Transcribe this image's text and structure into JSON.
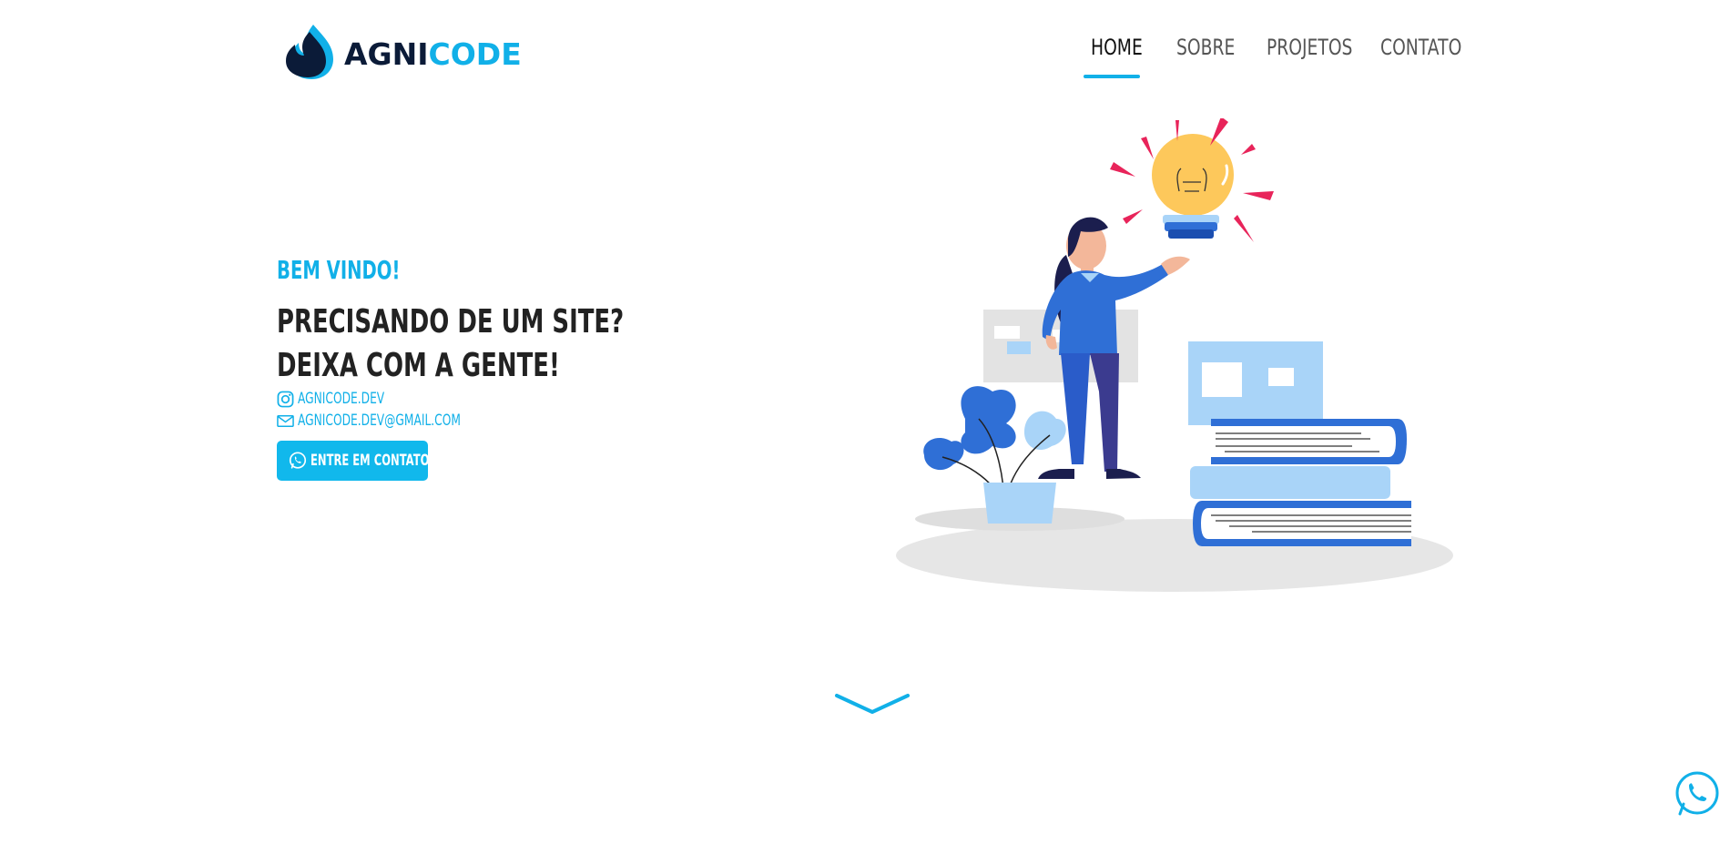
{
  "brand": {
    "part1": "AGNI",
    "part2": "CODE"
  },
  "nav": {
    "items": [
      {
        "label": "HOME",
        "active": true
      },
      {
        "label": "SOBRE",
        "active": false
      },
      {
        "label": "PROJETOS",
        "active": false
      },
      {
        "label": "CONTATO",
        "active": false
      }
    ]
  },
  "hero": {
    "welcome": "BEM VINDO!",
    "headline_1": "PRECISANDO DE UM SITE?",
    "headline_2": "DEIXA COM A GENTE!",
    "instagram": "AGNICODE.DEV",
    "email": "AGNICODE.DEV@GMAIL.COM",
    "cta_label": "ENTRE EM CONTATO"
  },
  "icons": {
    "logo": "flame-logo-icon",
    "instagram": "instagram-icon",
    "email": "envelope-icon",
    "cta": "whatsapp-icon",
    "scroll": "chevron-down-icon",
    "floating": "whatsapp-icon"
  },
  "colors": {
    "accent": "#11b0e8",
    "dark": "#0b1b38",
    "text": "#222222",
    "nav_inactive": "#555555"
  }
}
